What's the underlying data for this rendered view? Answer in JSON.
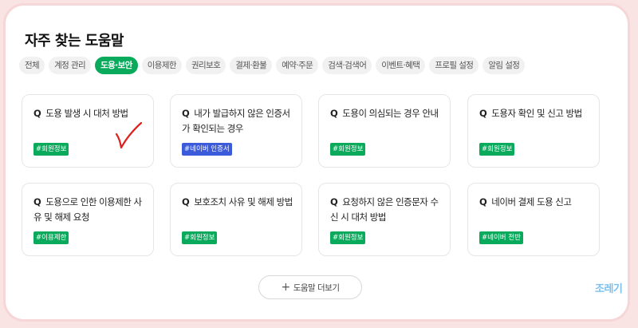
{
  "header": {
    "title": "자주 찾는 도움말"
  },
  "tabs": [
    {
      "label": "전체",
      "active": false
    },
    {
      "label": "계정 관리",
      "active": false
    },
    {
      "label": "도용·보안",
      "active": true
    },
    {
      "label": "이용제한",
      "active": false
    },
    {
      "label": "권리보호",
      "active": false
    },
    {
      "label": "결제·환불",
      "active": false
    },
    {
      "label": "예약·주문",
      "active": false
    },
    {
      "label": "검색·검색어",
      "active": false
    },
    {
      "label": "이벤트·혜택",
      "active": false
    },
    {
      "label": "프로필 설정",
      "active": false
    },
    {
      "label": "알림 설정",
      "active": false
    }
  ],
  "cards": [
    {
      "q": "Q",
      "text": "도용 발생 시 대처 방법",
      "tag": "#회원정보",
      "tag_color": "#09aa5c"
    },
    {
      "q": "Q",
      "text": "내가 발급하지 않은 인증서가 확인되는 경우",
      "tag": "#네이버 인증서",
      "tag_color": "#3b5bdb"
    },
    {
      "q": "Q",
      "text": "도용이 의심되는 경우 안내",
      "tag": "#회원정보",
      "tag_color": "#09aa5c"
    },
    {
      "q": "Q",
      "text": "도용자 확인 및 신고 방법",
      "tag": "#회원정보",
      "tag_color": "#09aa5c"
    },
    {
      "q": "Q",
      "text": "도용으로 인한 이용제한 사유 및 해제 요청",
      "tag": "#이용제한",
      "tag_color": "#09aa5c"
    },
    {
      "q": "Q",
      "text": "보호조치 사유 및 해제 방법",
      "tag": "#회원정보",
      "tag_color": "#09aa5c"
    },
    {
      "q": "Q",
      "text": "요청하지 않은 인증문자 수신 시 대처 방법",
      "tag": "#회원정보",
      "tag_color": "#09aa5c"
    },
    {
      "q": "Q",
      "text": "네이버 결제 도용 신고",
      "tag": "#네이버 전반",
      "tag_color": "#09aa5c"
    }
  ],
  "more_button": {
    "icon": "plus-icon",
    "label": "도움말 더보기"
  },
  "watermark": {
    "text": "조레기"
  },
  "colors": {
    "accent": "#09aa5c",
    "check": "#e0201c",
    "watermark": "#7ac0f0"
  }
}
